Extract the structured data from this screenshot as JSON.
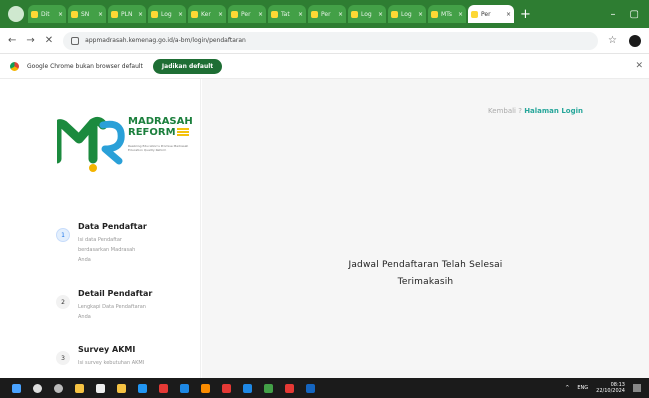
{
  "browser": {
    "tabs": [
      {
        "label": "Dit"
      },
      {
        "label": "SN"
      },
      {
        "label": "PLN"
      },
      {
        "label": "Log"
      },
      {
        "label": "Ker"
      },
      {
        "label": "Per"
      },
      {
        "label": "Tat"
      },
      {
        "label": "Per"
      },
      {
        "label": "Log"
      },
      {
        "label": "Log"
      },
      {
        "label": "MTs"
      },
      {
        "label": "Per",
        "active": true
      }
    ],
    "url": "appmadrasah.kemenag.go.id/a-bm/login/pendaftaran",
    "infobar_text": "Google Chrome bukan browser default",
    "infobar_button": "Jadikan default"
  },
  "sidebar": {
    "brand_line1": "MADRASAH",
    "brand_line2": "REFORM",
    "tagline": "Realizing Education's Promise Madrasah Education Quality Reform",
    "steps": [
      {
        "num": "1",
        "title": "Data Pendaftar",
        "desc": "Isi data Pendaftar berdasarkan Madrasah Anda"
      },
      {
        "num": "2",
        "title": "Detail Pendaftar",
        "desc": "Lengkapi Data Pendaftaran Anda"
      },
      {
        "num": "3",
        "title": "Survey AKMI",
        "desc": "Isi survey kebutuhan AKMI"
      }
    ]
  },
  "main": {
    "back_prefix": "Kembali ?",
    "back_link": "Halaman Login",
    "message_line1": "Jadwal Pendaftaran Telah Selesai",
    "message_line2": "Terimakasih"
  },
  "taskbar": {
    "time": "08:13",
    "date": "22/10/2024",
    "lang": "ENG"
  }
}
